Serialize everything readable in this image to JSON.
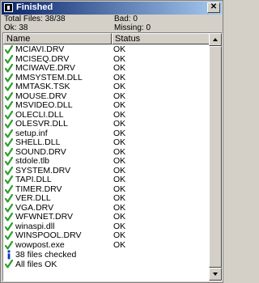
{
  "window": {
    "title": "Finished",
    "close_glyph": "✕"
  },
  "stats": {
    "total_files": "Total Files: 38/38",
    "ok": "Ok: 38",
    "bad": "Bad: 0",
    "missing": "Missing: 0"
  },
  "table": {
    "columns": [
      "Name",
      "Status"
    ],
    "rows": [
      {
        "name": "MCIAVI.DRV",
        "status": "OK"
      },
      {
        "name": "MCISEQ.DRV",
        "status": "OK"
      },
      {
        "name": "MCIWAVE.DRV",
        "status": "OK"
      },
      {
        "name": "MMSYSTEM.DLL",
        "status": "OK"
      },
      {
        "name": "MMTASK.TSK",
        "status": "OK"
      },
      {
        "name": "MOUSE.DRV",
        "status": "OK"
      },
      {
        "name": "MSVIDEO.DLL",
        "status": "OK"
      },
      {
        "name": "OLECLI.DLL",
        "status": "OK"
      },
      {
        "name": "OLESVR.DLL",
        "status": "OK"
      },
      {
        "name": "setup.inf",
        "status": "OK"
      },
      {
        "name": "SHELL.DLL",
        "status": "OK"
      },
      {
        "name": "SOUND.DRV",
        "status": "OK"
      },
      {
        "name": "stdole.tlb",
        "status": "OK"
      },
      {
        "name": "SYSTEM.DRV",
        "status": "OK"
      },
      {
        "name": "TAPI.DLL",
        "status": "OK"
      },
      {
        "name": "TIMER.DRV",
        "status": "OK"
      },
      {
        "name": "VER.DLL",
        "status": "OK"
      },
      {
        "name": "VGA.DRV",
        "status": "OK"
      },
      {
        "name": "WFWNET.DRV",
        "status": "OK"
      },
      {
        "name": "winaspi.dll",
        "status": "OK"
      },
      {
        "name": "WINSPOOL.DRV",
        "status": "OK"
      },
      {
        "name": "wowpost.exe",
        "status": "OK"
      }
    ],
    "summary": [
      {
        "icon": "info-icon",
        "text": "38 files checked"
      },
      {
        "icon": "check-icon",
        "text": "All files OK"
      }
    ]
  },
  "colors": {
    "check": "#2e9e2e",
    "info": "#1030c0"
  }
}
